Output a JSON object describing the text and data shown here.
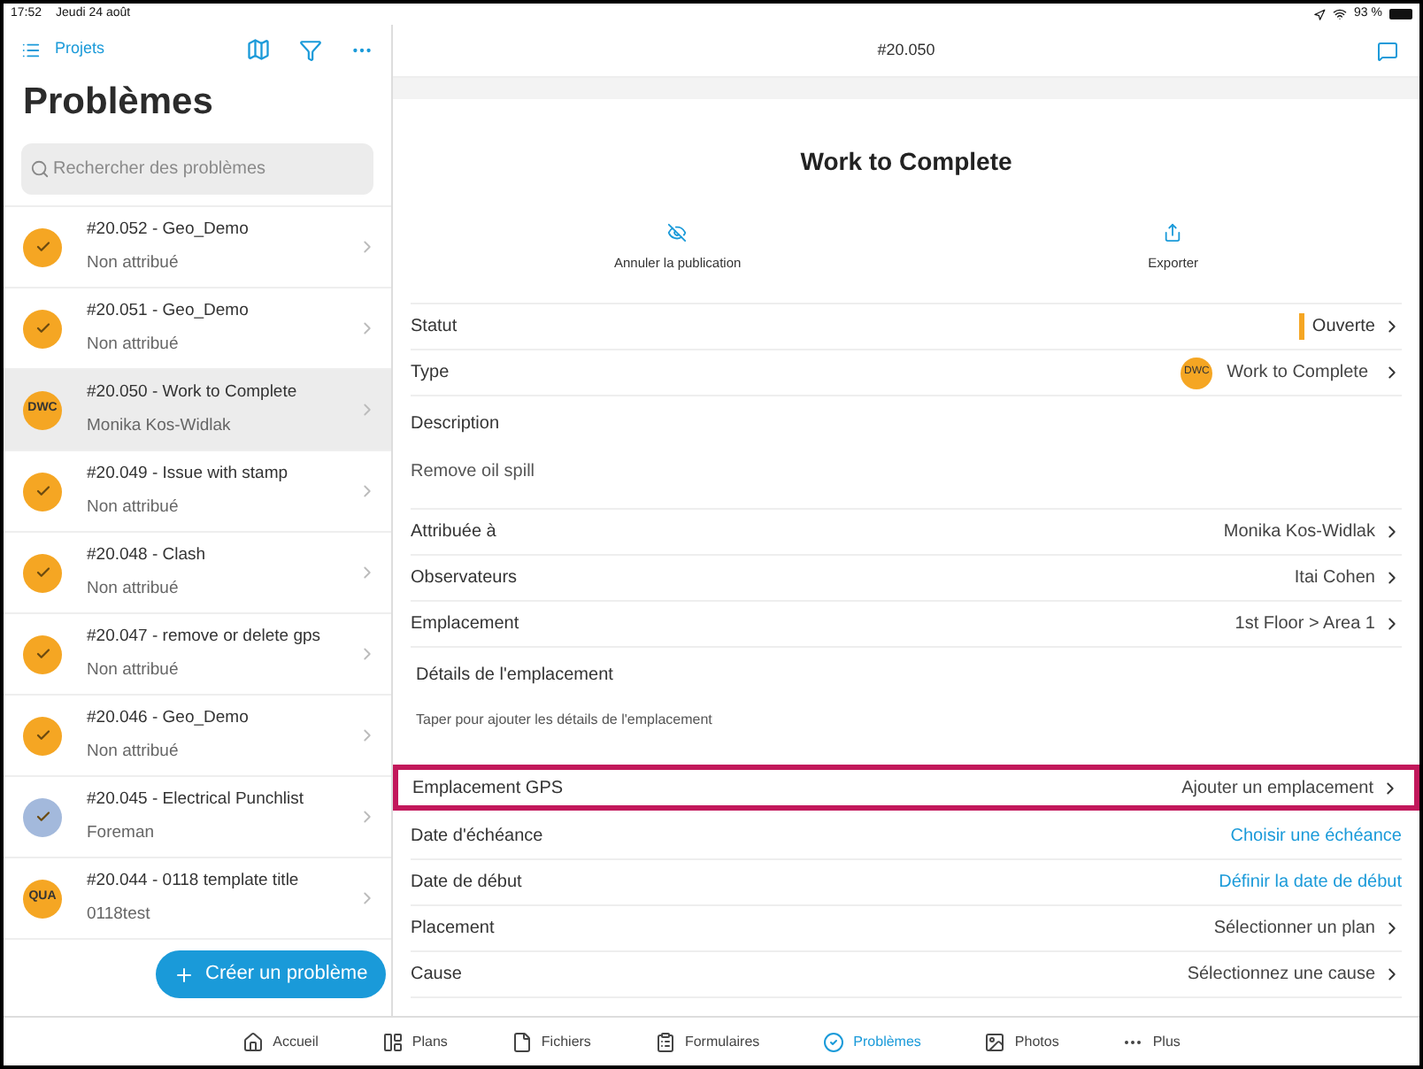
{
  "status_bar": {
    "time": "17:52",
    "date": "Jeudi 24 août",
    "battery": "93 %"
  },
  "sidebar": {
    "back_link": "Projets",
    "title": "Problèmes",
    "search": {
      "placeholder": "Rechercher des problèmes"
    },
    "items": [
      {
        "title": "#20.052 - Geo_Demo",
        "subtitle": "Non attribué",
        "avatar": {
          "kind": "check",
          "color": "#f5a623"
        },
        "selected": false
      },
      {
        "title": "#20.051 - Geo_Demo",
        "subtitle": "Non attribué",
        "avatar": {
          "kind": "check",
          "color": "#f5a623"
        },
        "selected": false
      },
      {
        "title": "#20.050 - Work to Complete",
        "subtitle": "Monika Kos-Widlak",
        "avatar": {
          "kind": "initials",
          "text": "DWC",
          "color": "#f5a623"
        },
        "selected": true
      },
      {
        "title": "#20.049 - Issue with stamp",
        "subtitle": "Non attribué",
        "avatar": {
          "kind": "check",
          "color": "#f5a623"
        },
        "selected": false
      },
      {
        "title": "#20.048 - Clash",
        "subtitle": "Non attribué",
        "avatar": {
          "kind": "check",
          "color": "#f5a623"
        },
        "selected": false
      },
      {
        "title": "#20.047 - remove or delete gps",
        "subtitle": "Non attribué",
        "avatar": {
          "kind": "check",
          "color": "#f5a623"
        },
        "selected": false
      },
      {
        "title": "#20.046 - Geo_Demo",
        "subtitle": "Non attribué",
        "avatar": {
          "kind": "check",
          "color": "#f5a623"
        },
        "selected": false
      },
      {
        "title": "#20.045 - Electrical Punchlist",
        "subtitle": "Foreman",
        "avatar": {
          "kind": "check",
          "color": "#a3b9dc"
        },
        "selected": false
      },
      {
        "title": "#20.044 - 0118 template title",
        "subtitle": "0118test",
        "avatar": {
          "kind": "initials",
          "text": "QUA",
          "color": "#f5a623"
        },
        "selected": false
      }
    ],
    "create_button": "Créer un problème"
  },
  "detail": {
    "header_title": "#20.050",
    "title": "Work to Complete",
    "actions": [
      {
        "label": "Annuler la publication",
        "kind": "unpublish"
      },
      {
        "label": "Exporter",
        "kind": "export"
      }
    ],
    "fields": [
      {
        "kind": "status",
        "label": "Statut",
        "value": "Ouverte",
        "color": "#f5a623"
      },
      {
        "kind": "type",
        "label": "Type",
        "value": "Work to Complete",
        "badge": "DWC",
        "color": "#f5a623"
      },
      {
        "kind": "text",
        "label": "Description",
        "value": "Remove oil spill"
      },
      {
        "kind": "value",
        "label": "Attribuée à",
        "value": "Monika Kos-Widlak"
      },
      {
        "kind": "value",
        "label": "Observateurs",
        "value": "Itai Cohen"
      },
      {
        "kind": "value",
        "label": "Emplacement",
        "value": "1st Floor > Area 1"
      },
      {
        "kind": "details",
        "label": "Détails de l'emplacement",
        "placeholder": "Taper pour ajouter les détails de l'emplacement"
      },
      {
        "kind": "value",
        "label": "Emplacement GPS",
        "value": "Ajouter un emplacement",
        "highlighted": true
      },
      {
        "kind": "link",
        "label": "Date d'échéance",
        "value": "Choisir une échéance"
      },
      {
        "kind": "link",
        "label": "Date de début",
        "value": "Définir la date de début"
      },
      {
        "kind": "value",
        "label": "Placement",
        "value": "Sélectionner un plan"
      },
      {
        "kind": "value",
        "label": "Cause",
        "value": "Sélectionnez une cause"
      }
    ]
  },
  "tab_bar": [
    {
      "label": "Accueil",
      "kind": "home",
      "selected": false
    },
    {
      "label": "Plans",
      "kind": "plans",
      "selected": false
    },
    {
      "label": "Fichiers",
      "kind": "file",
      "selected": false
    },
    {
      "label": "Formulaires",
      "kind": "clipboard",
      "selected": false
    },
    {
      "label": "Problèmes",
      "kind": "check",
      "selected": true
    },
    {
      "label": "Photos",
      "kind": "photos",
      "selected": false
    },
    {
      "label": "Plus",
      "kind": "more",
      "selected": false
    }
  ]
}
